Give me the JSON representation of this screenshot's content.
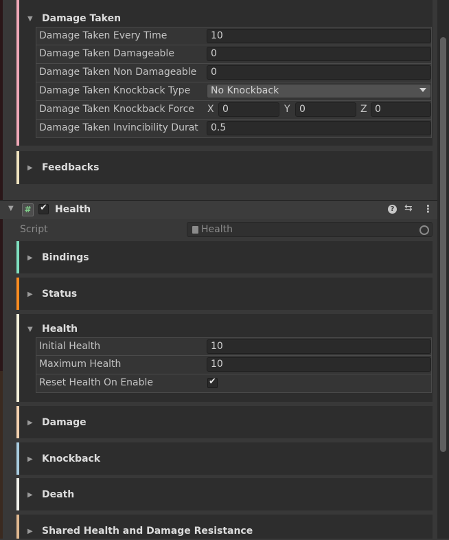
{
  "colors": {
    "accent_pink": "#f0a8b8",
    "accent_cream": "#f0e4c0",
    "accent_mint": "#7fe0c0",
    "accent_orange": "#ff8c20",
    "accent_ivory": "#f6f2dc",
    "accent_peach": "#f4d2b0",
    "accent_blue": "#a8cce0",
    "accent_white": "#f2f2ec",
    "accent_tan": "#e0b890"
  },
  "damage_taken": {
    "title": "Damage Taken",
    "fields": [
      {
        "label": "Damage Taken Every Time",
        "value": "10"
      },
      {
        "label": "Damage Taken Damageable",
        "value": "0"
      },
      {
        "label": "Damage Taken Non Damageable",
        "value": "0"
      }
    ],
    "knockback_type": {
      "label": "Damage Taken Knockback Type",
      "value": "No Knockback"
    },
    "knockback_force": {
      "label": "Damage Taken Knockback Force",
      "x_label": "X",
      "x": "0",
      "y_label": "Y",
      "y": "0",
      "z_label": "Z",
      "z": "0"
    },
    "invincibility": {
      "label": "Damage Taken Invincibility Durat",
      "value": "0.5"
    }
  },
  "feedbacks": {
    "title": "Feedbacks"
  },
  "component": {
    "title": "Health",
    "hash_glyph": "#",
    "enabled": true,
    "script_label": "Script",
    "script_value": "Health"
  },
  "sections": {
    "bindings": "Bindings",
    "status": "Status",
    "health": "Health",
    "damage": "Damage",
    "knockback": "Knockback",
    "death": "Death",
    "shared": "Shared Health and Damage Resistance"
  },
  "health_fields": {
    "initial_label": "Initial Health",
    "initial_value": "10",
    "max_label": "Maximum Health",
    "max_value": "10",
    "reset_label": "Reset Health On Enable",
    "reset_checked": true
  }
}
